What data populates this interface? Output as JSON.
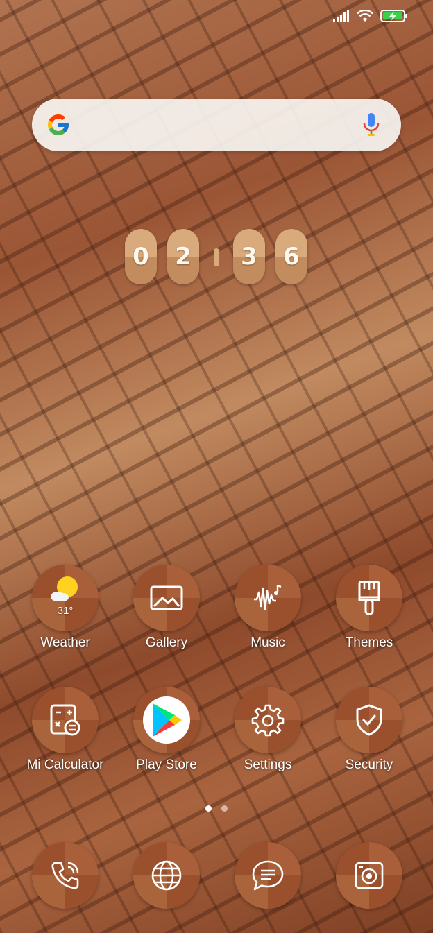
{
  "status_bar": {
    "icons": [
      "signal-icon",
      "wifi-icon",
      "battery-charging-icon"
    ]
  },
  "search": {
    "logo": "google-g-icon",
    "mic": "mic-icon"
  },
  "clock": {
    "h1": "0",
    "h2": "2",
    "m1": "3",
    "m2": "6"
  },
  "apps_row1": [
    {
      "label": "Weather",
      "icon": "weather-sun-cloud-icon",
      "temp": "31°"
    },
    {
      "label": "Gallery",
      "icon": "gallery-icon"
    },
    {
      "label": "Music",
      "icon": "music-icon"
    },
    {
      "label": "Themes",
      "icon": "paintbrush-icon"
    }
  ],
  "apps_row2": [
    {
      "label": "Mi Calculator",
      "icon": "calculator-icon"
    },
    {
      "label": "Play Store",
      "icon": "play-store-icon"
    },
    {
      "label": "Settings",
      "icon": "gear-icon"
    },
    {
      "label": "Security",
      "icon": "shield-icon"
    }
  ],
  "page_dots": {
    "count": 2,
    "active": 1
  },
  "dock": [
    {
      "icon": "phone-icon"
    },
    {
      "icon": "browser-globe-icon"
    },
    {
      "icon": "messages-icon"
    },
    {
      "icon": "camera-icon"
    }
  ],
  "colors": {
    "icon_bg": "#9a4f2d",
    "clock_digit": "#d8aa7c"
  }
}
